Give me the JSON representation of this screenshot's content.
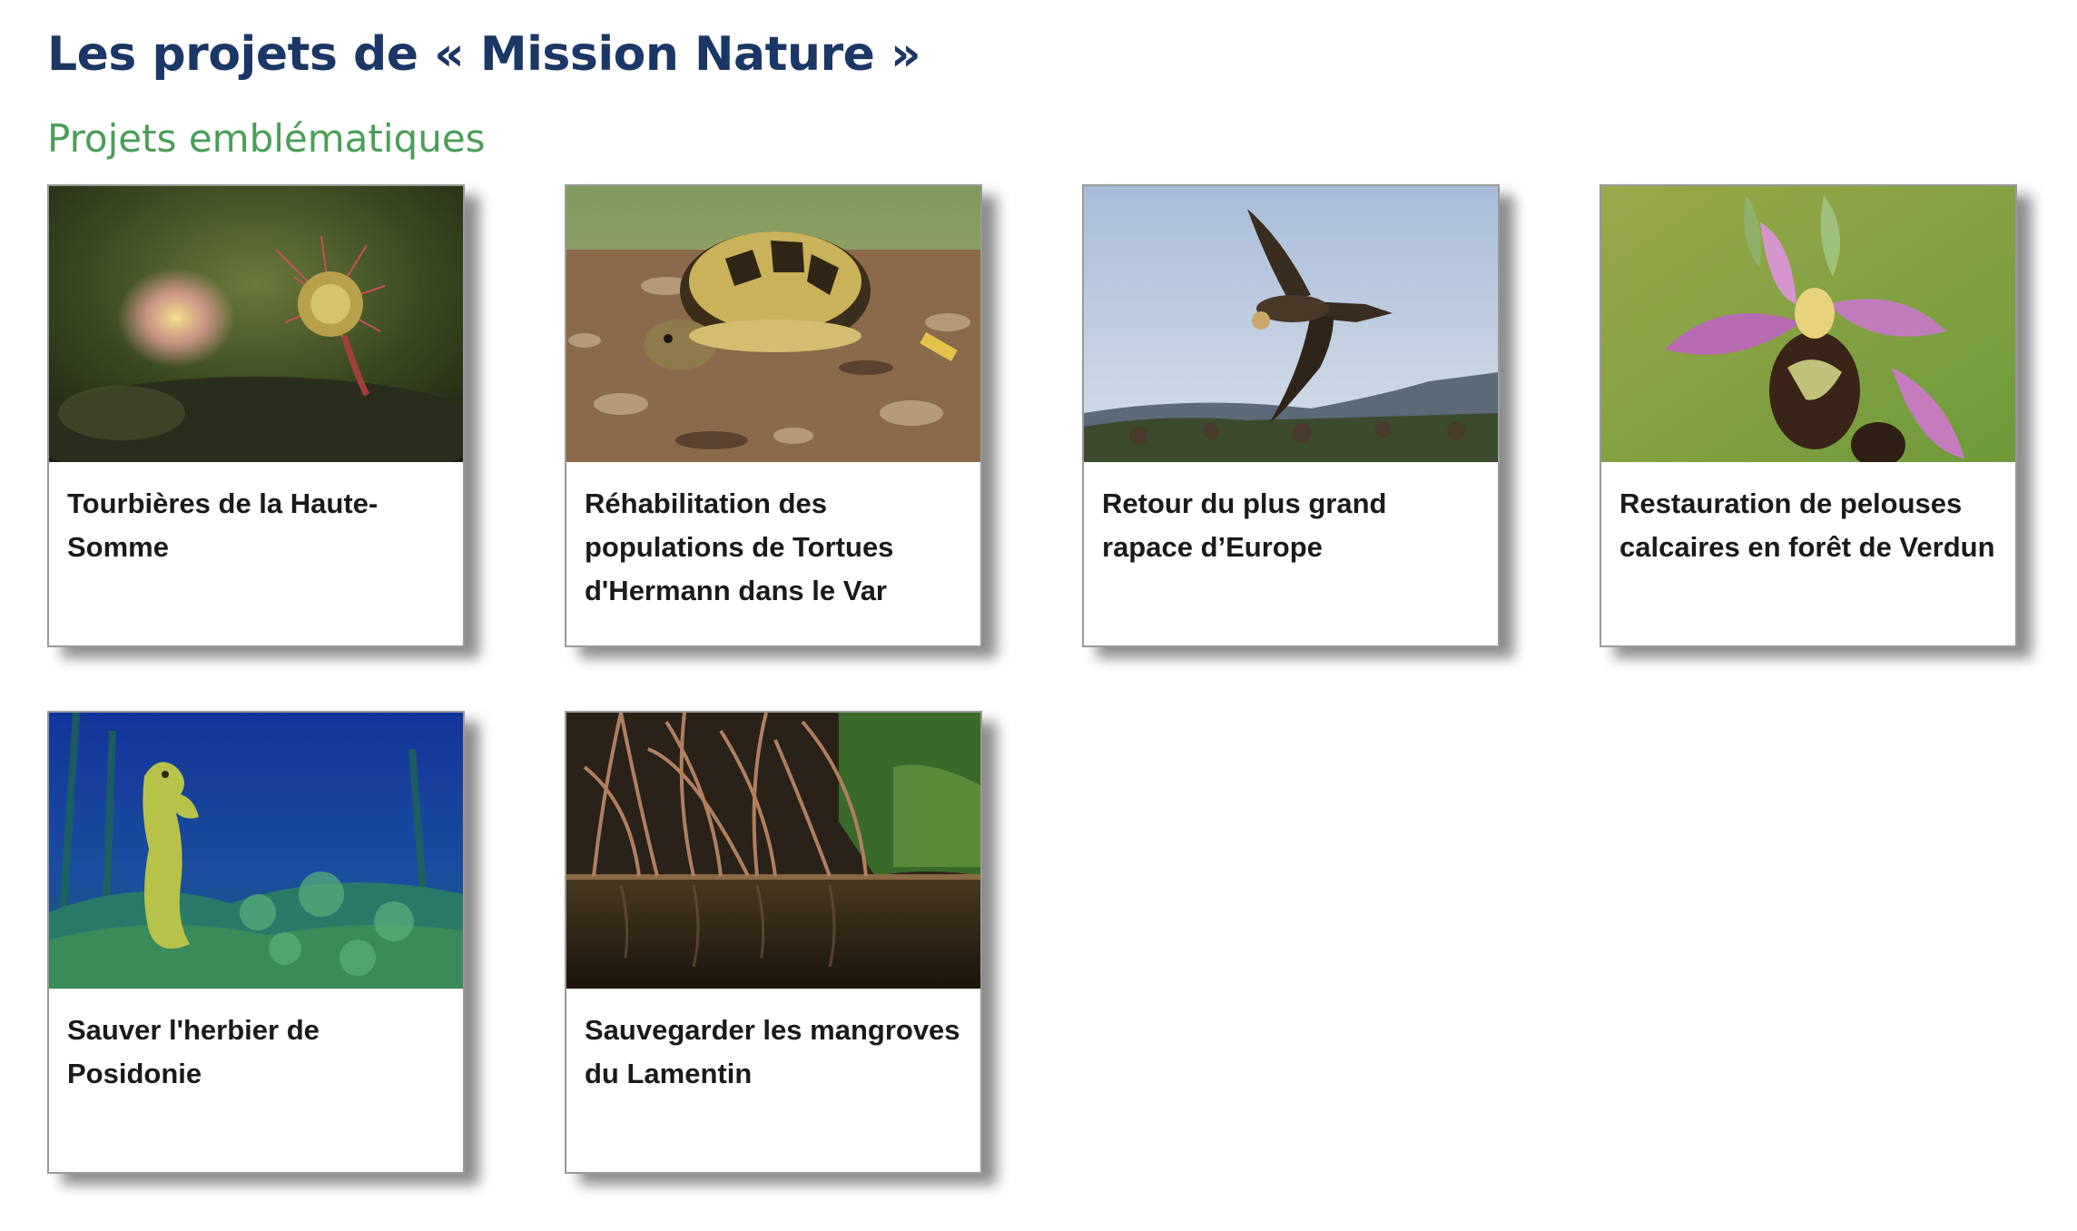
{
  "page": {
    "title": "Les projets de « Mission Nature »",
    "section_title": "Projets emblématiques"
  },
  "colors": {
    "title": "#1b3765",
    "section": "#4a9e57"
  },
  "projects": [
    {
      "title": "Tourbières de la Haute-Somme",
      "image": "sundew-plant-photo"
    },
    {
      "title": "Réhabilitation des populations de Tortues d'Hermann dans le Var",
      "image": "tortoise-photo"
    },
    {
      "title": "Retour du plus grand rapace d’Europe",
      "image": "vulture-flying-photo"
    },
    {
      "title": "Restauration de pelouses calcaires en forêt de Verdun",
      "image": "orchid-photo"
    },
    {
      "title": "Sauver l'herbier de Posidonie",
      "image": "seahorse-seagrass-photo"
    },
    {
      "title": "Sauvegarder les mangroves du Lamentin",
      "image": "mangrove-roots-photo"
    }
  ]
}
